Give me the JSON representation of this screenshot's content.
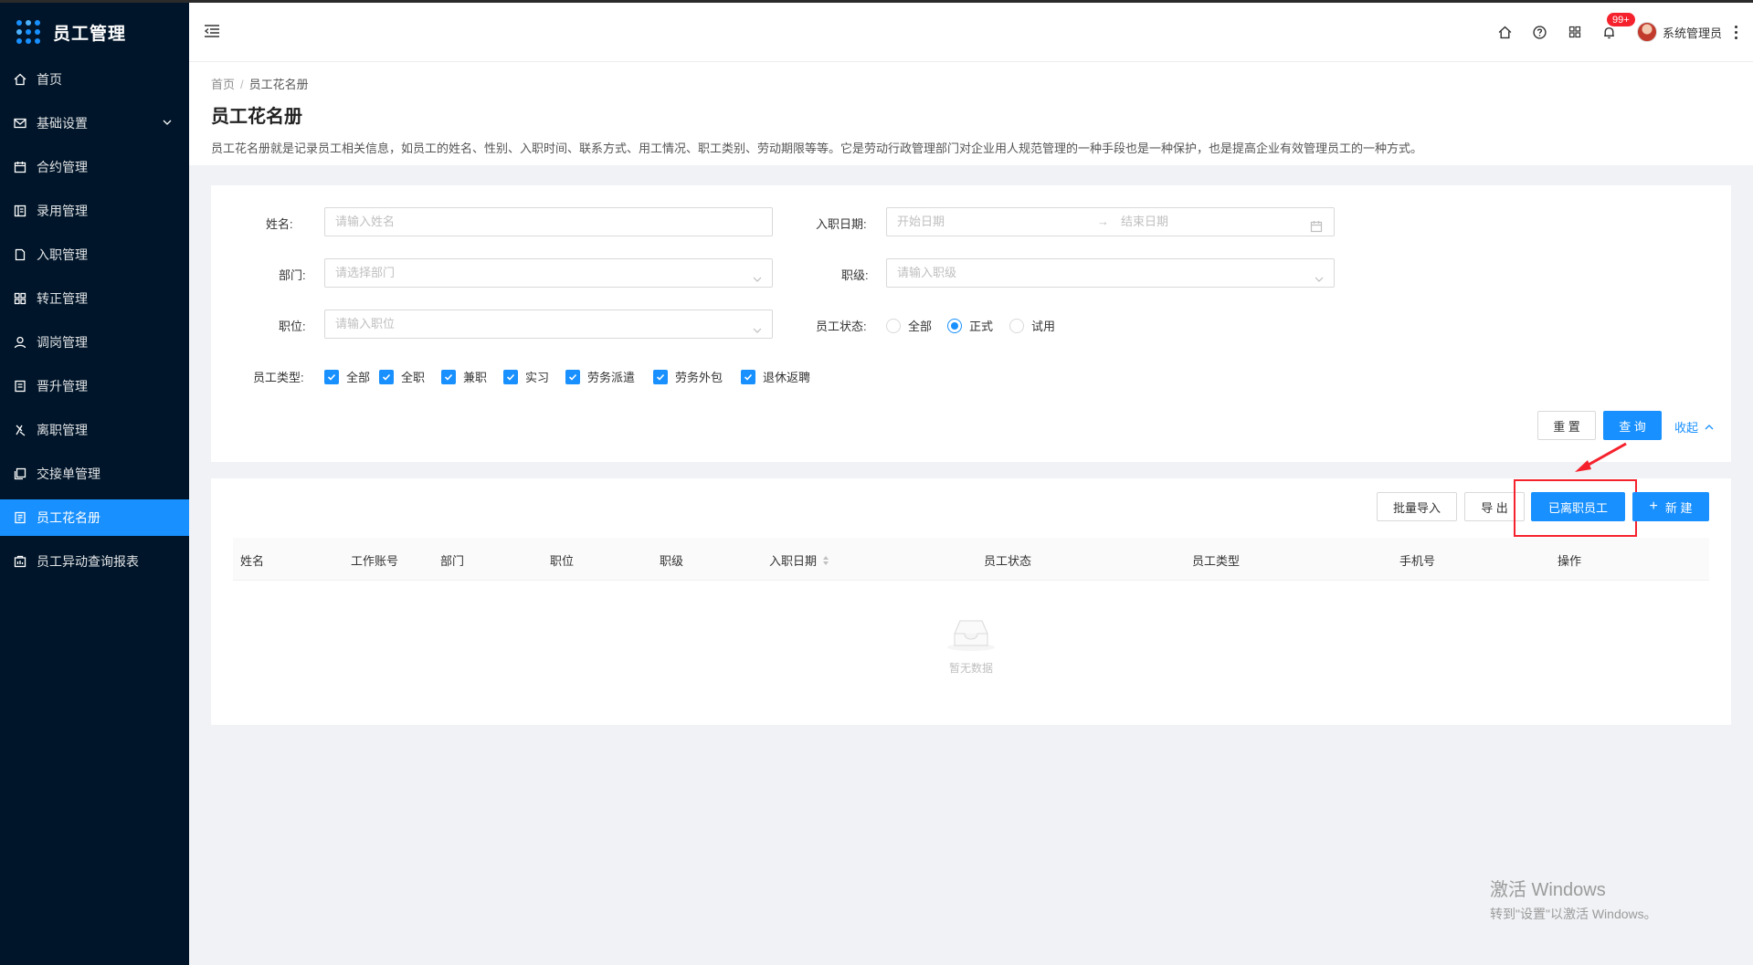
{
  "app": {
    "title": "员工管理"
  },
  "sidebar": {
    "items": [
      {
        "label": "首页",
        "icon": "home-icon"
      },
      {
        "label": "基础设置",
        "icon": "mail-icon",
        "expandable": true
      },
      {
        "label": "合约管理",
        "icon": "calendar-icon"
      },
      {
        "label": "录用管理",
        "icon": "book-icon"
      },
      {
        "label": "入职管理",
        "icon": "file-icon"
      },
      {
        "label": "转正管理",
        "icon": "grid-icon"
      },
      {
        "label": "调岗管理",
        "icon": "user-icon"
      },
      {
        "label": "晋升管理",
        "icon": "doc-icon"
      },
      {
        "label": "离职管理",
        "icon": "leave-icon"
      },
      {
        "label": "交接单管理",
        "icon": "copy-icon"
      },
      {
        "label": "员工花名册",
        "icon": "roster-icon",
        "active": true
      },
      {
        "label": "员工异动查询报表",
        "icon": "report-icon"
      }
    ]
  },
  "header": {
    "badge": "99+",
    "username": "系统管理员"
  },
  "page": {
    "breadcrumb": [
      "首页",
      "员工花名册"
    ],
    "title": "员工花名册",
    "description": "员工花名册就是记录员工相关信息，如员工的姓名、性别、入职时间、联系方式、用工情况、职工类别、劳动期限等等。它是劳动行政管理部门对企业用人规范管理的一种手段也是一种保护，也是提高企业有效管理员工的一种方式。"
  },
  "filters": {
    "name": {
      "label": "姓名:",
      "placeholder": "请输入姓名"
    },
    "hire_date": {
      "label": "入职日期:",
      "start_placeholder": "开始日期",
      "end_placeholder": "结束日期"
    },
    "department": {
      "label": "部门:",
      "placeholder": "请选择部门"
    },
    "rank": {
      "label": "职级:",
      "placeholder": "请输入职级"
    },
    "position": {
      "label": "职位:",
      "placeholder": "请输入职位"
    },
    "status": {
      "label": "员工状态:",
      "options": [
        "全部",
        "正式",
        "试用"
      ],
      "selected": "正式"
    },
    "types": {
      "label": "员工类型:",
      "options": [
        "全部",
        "全职",
        "兼职",
        "实习",
        "劳务派遣",
        "劳务外包",
        "退休返聘"
      ]
    },
    "reset_label": "重 置",
    "search_label": "查 询",
    "collapse_label": "收起"
  },
  "toolbar": {
    "import_label": "批量导入",
    "export_label": "导 出",
    "resigned_label": "已离职员工",
    "new_label": "新 建"
  },
  "table": {
    "columns": [
      "姓名",
      "工作账号",
      "部门",
      "职位",
      "职级",
      "入职日期",
      "员工状态",
      "员工类型",
      "手机号",
      "操作"
    ],
    "empty_text": "暂无数据"
  },
  "watermark": {
    "line1": "激活 Windows",
    "line2": "转到\"设置\"以激活 Windows。"
  },
  "colors": {
    "sidebar_bg": "#001529",
    "primary": "#1890ff",
    "highlight": "#f5222d"
  }
}
